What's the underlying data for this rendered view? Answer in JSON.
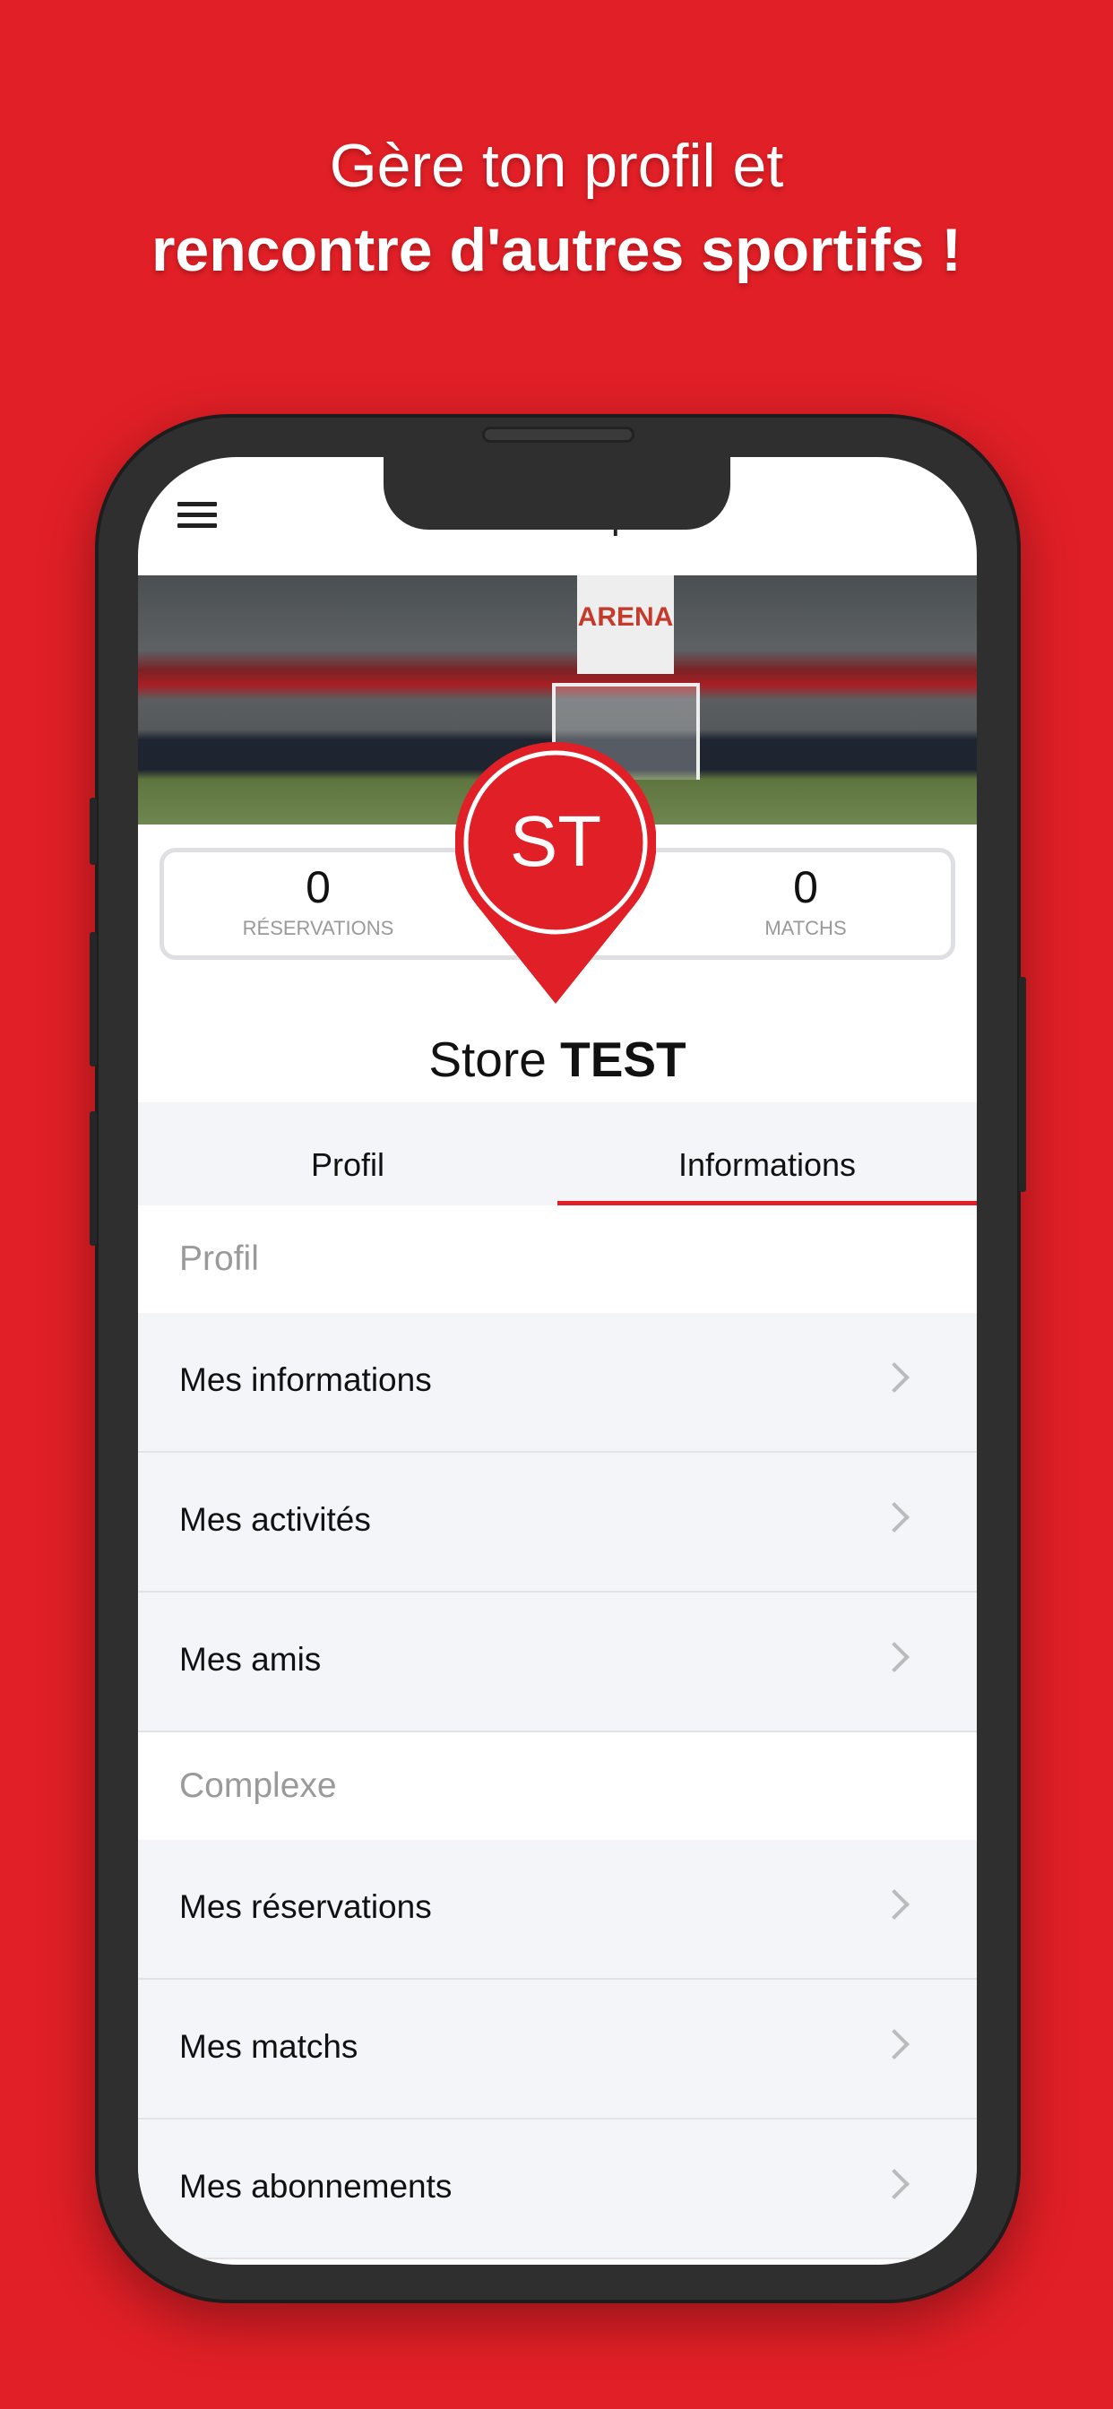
{
  "headline": {
    "line1": "Gère ton profil et",
    "line2": "rencontre d'autres sportifs !"
  },
  "header": {
    "title": "Mon compte",
    "menu_icon": "hamburger-icon"
  },
  "banner": {
    "sign_text": "ARENA"
  },
  "avatar": {
    "initials": "ST",
    "color": "#e11f26"
  },
  "stats": [
    {
      "value": "0",
      "label": "RÉSERVATIONS"
    },
    {
      "value": "0",
      "label": "MATCHS"
    }
  ],
  "user": {
    "first": "Store",
    "last": "TEST"
  },
  "tabs": [
    {
      "label": "Profil"
    },
    {
      "label": "Informations",
      "active": true
    }
  ],
  "sections": [
    {
      "title": "Profil",
      "items": [
        "Mes informations",
        "Mes activités",
        "Mes amis"
      ]
    },
    {
      "title": "Complexe",
      "items": [
        "Mes réservations",
        "Mes matchs",
        "Mes abonnements"
      ]
    }
  ],
  "colors": {
    "accent": "#e11f26"
  }
}
